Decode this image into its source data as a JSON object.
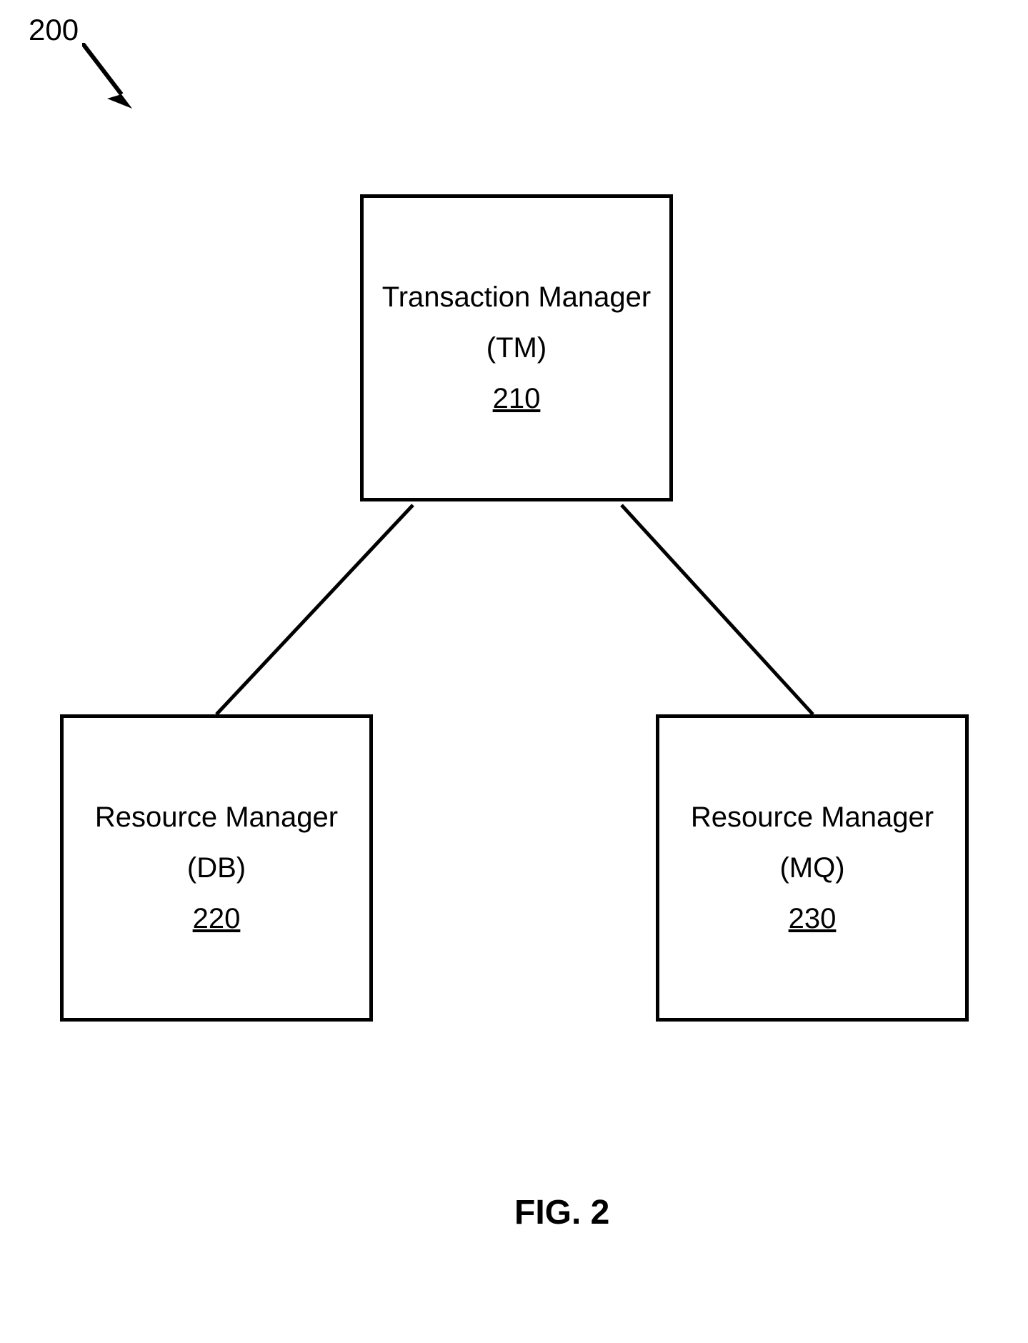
{
  "diagram": {
    "reference_number": "200",
    "figure_caption": "FIG. 2",
    "boxes": {
      "top": {
        "title": "Transaction Manager",
        "subtitle": "(TM)",
        "id": "210"
      },
      "left": {
        "title": "Resource Manager",
        "subtitle": "(DB)",
        "id": "220"
      },
      "right": {
        "title": "Resource Manager",
        "subtitle": "(MQ)",
        "id": "230"
      }
    }
  }
}
